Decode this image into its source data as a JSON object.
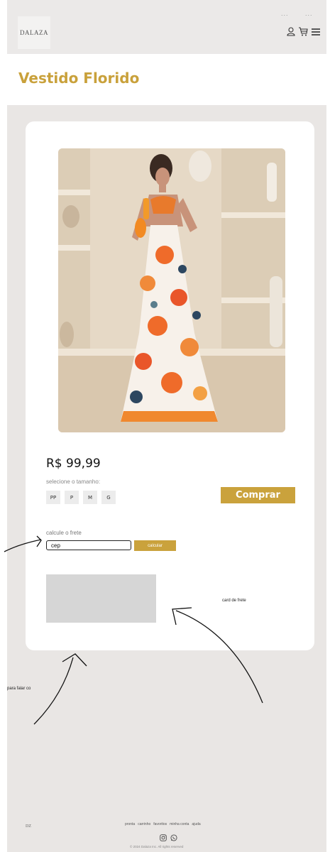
{
  "brand": {
    "logo_text": "DALAZA",
    "footer_logo_text": "DZ"
  },
  "header": {
    "dots_left": "...",
    "dots_right": "...",
    "icons": [
      "user-icon",
      "cart-icon",
      "menu-icon"
    ]
  },
  "product": {
    "title": "Vestido Florido",
    "price": "R$ 99,99",
    "size_label": "selecione o tamanho:",
    "sizes": [
      "PP",
      "P",
      "M",
      "G"
    ],
    "buy_label": "Comprar"
  },
  "freight": {
    "label": "calcule o frete",
    "cep_value": "cep",
    "calculate_label": "calcular"
  },
  "annotations": {
    "card_freight": "card de frete",
    "left_note": "para falar co"
  },
  "footer": {
    "nav": [
      "pronta",
      "carrinho",
      "favoritos",
      "minha conta",
      "ajuda"
    ],
    "social_icons": [
      "instagram-icon",
      "whatsapp-icon"
    ],
    "copyright": "© 2024 Dalaza Inc. All rights reserved"
  },
  "colors": {
    "accent": "#caa23c",
    "title": "#c9a13b",
    "page_bg": "#e9e6e4",
    "card_bg": "#ffffff"
  }
}
